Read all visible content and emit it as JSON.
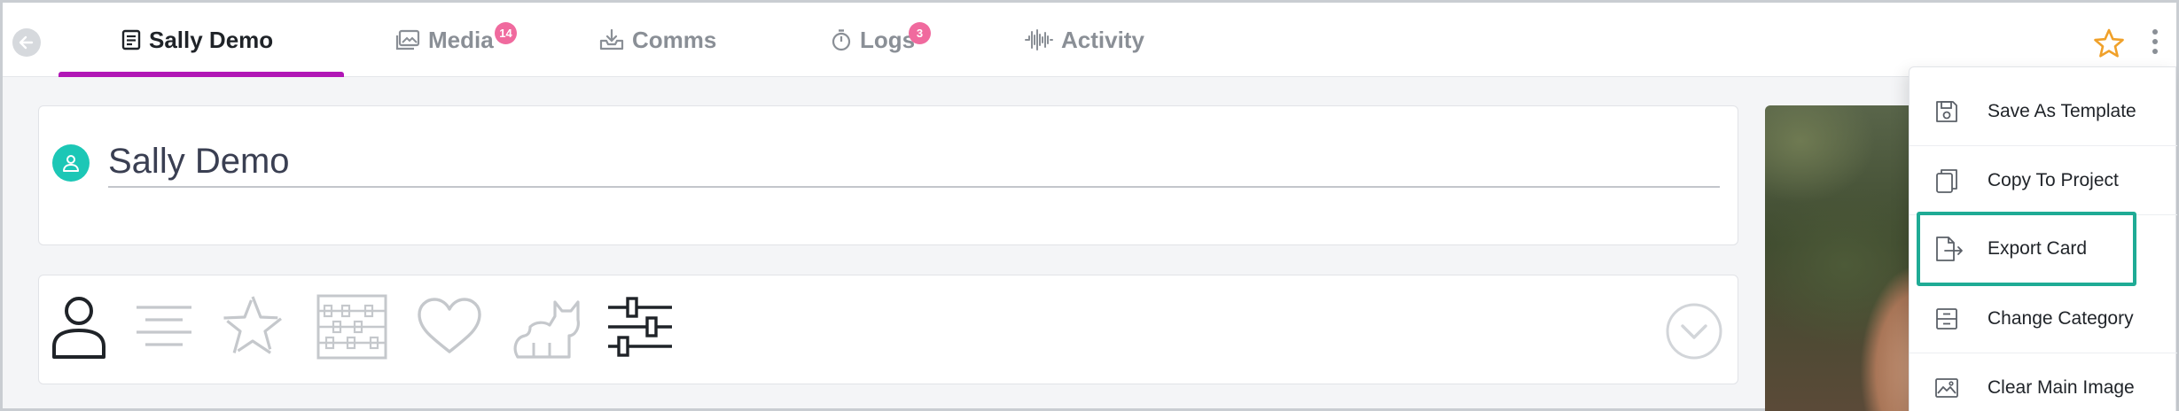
{
  "tabs": [
    {
      "label": "Sally Demo",
      "icon": "card-icon",
      "active": true,
      "badge": null
    },
    {
      "label": "Media",
      "icon": "media-icon",
      "active": false,
      "badge": "14"
    },
    {
      "label": "Comms",
      "icon": "inbox-icon",
      "active": false,
      "badge": null
    },
    {
      "label": "Logs",
      "icon": "stopwatch-icon",
      "active": false,
      "badge": "3"
    },
    {
      "label": "Activity",
      "icon": "waveform-icon",
      "active": false,
      "badge": null
    }
  ],
  "record": {
    "name": "Sally Demo"
  },
  "section_icons": [
    {
      "name": "person-icon",
      "active": true
    },
    {
      "name": "lines-icon",
      "active": false
    },
    {
      "name": "star-outline-icon",
      "active": false
    },
    {
      "name": "abacus-icon",
      "active": false
    },
    {
      "name": "heart-icon",
      "active": false
    },
    {
      "name": "cat-icon",
      "active": false
    },
    {
      "name": "sliders-icon",
      "active": true
    }
  ],
  "menu": {
    "items": [
      {
        "label": "Save As Template",
        "icon": "floppy-icon"
      },
      {
        "label": "Copy To Project",
        "icon": "copy-icon"
      },
      {
        "label": "Export Card",
        "icon": "export-file-icon",
        "highlighted": true
      },
      {
        "label": "Change Category",
        "icon": "drawer-icon"
      },
      {
        "label": "Clear Main Image",
        "icon": "image-icon"
      }
    ]
  },
  "colors": {
    "accent_underline": "#b117b6",
    "badge": "#f06a9e",
    "avatar": "#1cc7b6",
    "highlight_border": "#1fab95",
    "star": "#f0a12a"
  }
}
